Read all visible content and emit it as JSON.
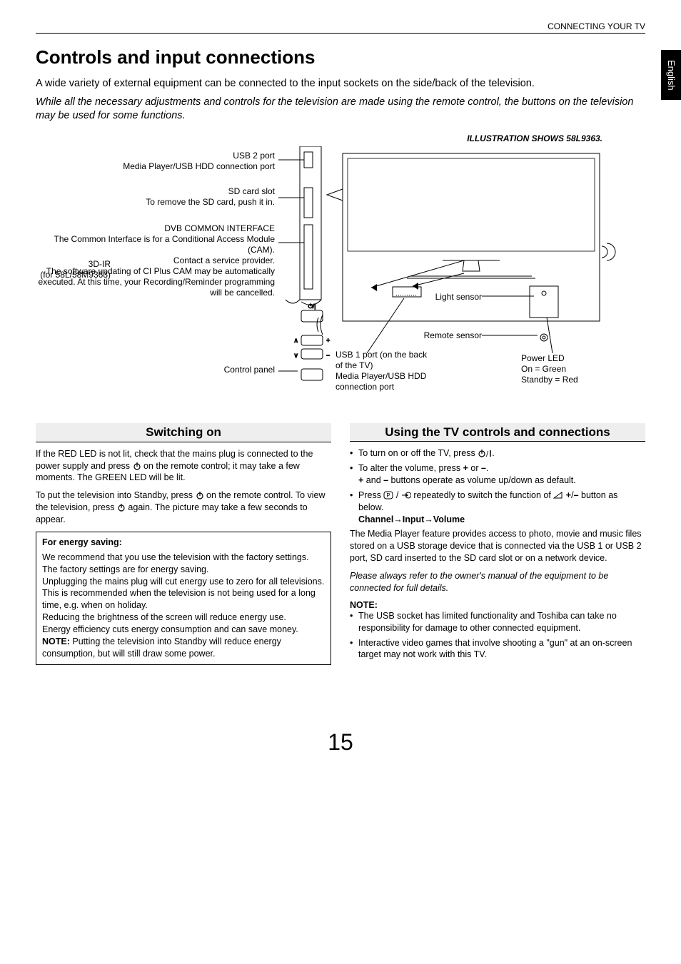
{
  "running_head": "CONNECTING YOUR TV",
  "side_tab": "English",
  "title": "Controls and input connections",
  "intro1": "A wide variety of external equipment can be connected to the input sockets on the side/back of the television.",
  "intro2": "While all the necessary adjustments and controls for the television are made using the remote control, the buttons on the television may be used for some functions.",
  "illustration_caption": "ILLUSTRATION SHOWS 58L9363.",
  "diagram": {
    "usb2_l1": "USB 2 port",
    "usb2_l2": "Media Player/USB HDD connection port",
    "sd_l1": "SD card slot",
    "sd_l2": "To remove the SD card, push it in.",
    "dvb_l1": "DVB COMMON INTERFACE",
    "dvb_l2": "The Common Interface is for a Conditional Access Module (CAM).",
    "dvb_l3": "Contact a service provider.",
    "dvb_l4": "The software updating of CI Plus CAM may be automatically executed. At this time, your Recording/Reminder programming will be cancelled.",
    "control_panel": "Control panel",
    "ir_l1": "3D-IR",
    "ir_l2": "(for 58L/58M9363)",
    "light_sensor": "Light sensor",
    "remote_sensor": "Remote sensor",
    "usb1_l1": "USB 1 port (on the back of the TV)",
    "usb1_l2": "Media Player/USB HDD connection port",
    "power_l1": "Power LED",
    "power_l2": "On = Green",
    "power_l3": "Standby = Red"
  },
  "left": {
    "heading": "Switching on",
    "p1a": "If the RED LED is not lit, check that the mains plug is connected to the power supply and press ",
    "p1b": " on the remote control; it may take a few moments. The GREEN LED will be lit.",
    "p2a": "To put the television into Standby, press ",
    "p2b": " on the remote control. To view the television, press ",
    "p2c": " again. The picture may take a few seconds to appear.",
    "box_head": "For energy saving:",
    "b1": "We recommend that you use the television with the factory settings. The factory settings are for energy saving.",
    "b2": "Unplugging the mains plug will cut energy use to zero for all televisions. This is recommended when the television is not being used for a long time, e.g. when on holiday.",
    "b3": "Reducing the brightness of the screen will reduce energy use.",
    "b4": "Energy efficiency cuts energy consumption and can save money.",
    "note_label": "NOTE:",
    "note_text": " Putting the television into Standby will reduce energy consumption, but will still draw some power."
  },
  "right": {
    "heading": "Using the TV controls and connections",
    "li1a": "To turn on or off the TV, press ",
    "li1b": ".",
    "li2_pre": "To alter the volume, press ",
    "li2_plus": "+",
    "li2_or": " or ",
    "li2_minus": "–",
    "li2_post": ".",
    "li2_sub_a": "+",
    "li2_sub_b": " and ",
    "li2_sub_c": "–",
    "li2_sub_d": " buttons operate as volume up/down as default.",
    "li3a": "Press ",
    "li3b": " / ",
    "li3c": " repeatedly to switch the function of ",
    "li3d": " ",
    "li3_plus": "+",
    "li3_slash": "/",
    "li3_minus": "–",
    "li3e": " button as below.",
    "li3_sub": "Channel→Input→Volume",
    "p_media": "The Media Player feature provides access to photo, movie and music files stored on a USB storage device that is connected via the USB 1 or USB 2 port, SD card inserted to the SD card slot or on a network device.",
    "p_owner": "Please always refer to the owner's manual of the equipment to be connected for full details.",
    "note_label": "NOTE:",
    "n1": "The USB socket has limited functionality and Toshiba can take no responsibility for damage to other connected equipment.",
    "n2": "Interactive video games that involve shooting a \"gun\" at an on-screen target may not work with this TV."
  },
  "page_number": "15"
}
